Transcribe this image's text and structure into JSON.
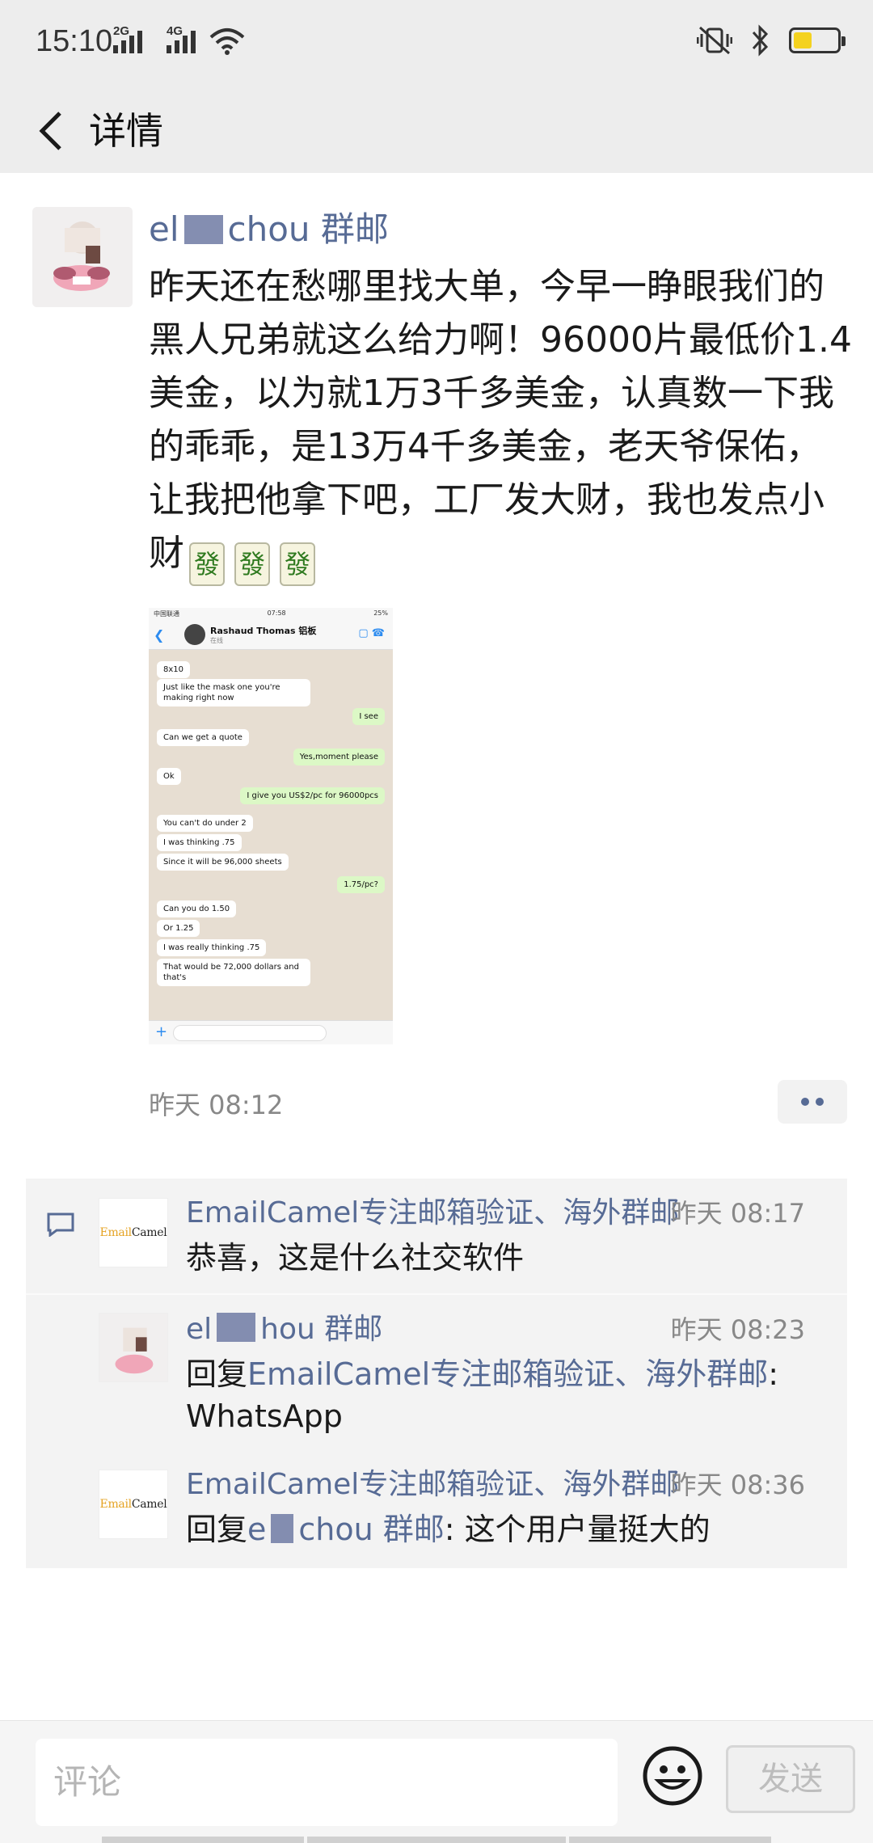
{
  "status_bar": {
    "time": "15:10",
    "signal1_label": "2G",
    "signal2_label": "4G",
    "battery_color": "#f4d21f"
  },
  "header": {
    "title": "详情"
  },
  "post": {
    "author_prefix": "el",
    "author_suffix": "chou 群邮",
    "text": "昨天还在愁哪里找大单，今早一睁眼我们的黑人兄弟就这么给力啊！96000片最低价1.4美金，以为就1万3千多美金，认真数一下我的乖乖，是13万4千多美金，老天爷保佑，让我把他拿下吧，工厂发大财，我也发点小财",
    "emoji": [
      "發",
      "發",
      "發"
    ],
    "time": "昨天 08:12"
  },
  "shared_screenshot": {
    "status_left": "中国联通",
    "status_time": "07:58",
    "status_battery": "25%",
    "contact_name": "Rashaud Thomas 铝板",
    "contact_sub": "在线",
    "messages": [
      {
        "dir": "in",
        "text": "8x10"
      },
      {
        "dir": "in",
        "text": "Just like the mask one you're making right now"
      },
      {
        "dir": "out",
        "text": "I see"
      },
      {
        "dir": "in",
        "text": "Can we get a quote"
      },
      {
        "dir": "out",
        "text": "Yes,moment please"
      },
      {
        "dir": "in",
        "text": "Ok"
      },
      {
        "dir": "out",
        "text": "I give you US$2/pc for 96000pcs"
      },
      {
        "dir": "in",
        "text": "You can't do under 2"
      },
      {
        "dir": "in",
        "text": "I was thinking .75"
      },
      {
        "dir": "in",
        "text": "Since it will be 96,000 sheets"
      },
      {
        "dir": "out",
        "text": "1.75/pc?"
      },
      {
        "dir": "in",
        "text": "Can you do 1.50"
      },
      {
        "dir": "in",
        "text": "Or 1.25"
      },
      {
        "dir": "in",
        "text": "I was really thinking .75"
      },
      {
        "dir": "in",
        "text": "That would be 72,000 dollars and that's"
      }
    ]
  },
  "comments": [
    {
      "author": "EmailCamel专注邮箱验证、海外群邮",
      "time": "昨天 08:17",
      "text": "恭喜，这是什么社交软件",
      "avatar_logo": [
        "Email",
        "Camel"
      ]
    },
    {
      "author_prefix": "el",
      "author_suffix": "hou 群邮",
      "time": "昨天 08:23",
      "reply_prefix": "回复",
      "reply_to": "EmailCamel专注邮箱验证、海外群邮",
      "text": "WhatsApp"
    },
    {
      "author": "EmailCamel专注邮箱验证、海外群邮",
      "time": "昨天 08:36",
      "reply_prefix": "回复",
      "reply_to_prefix": "e",
      "reply_to_suffix": "chou 群邮",
      "text": ": 这个用户量挺大的",
      "avatar_logo": [
        "Email",
        "Camel"
      ]
    }
  ],
  "bottom_bar": {
    "comment_placeholder": "评论",
    "send_label": "发送"
  }
}
